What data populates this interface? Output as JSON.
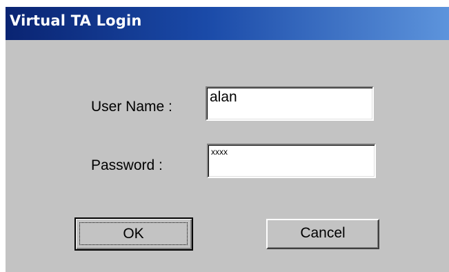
{
  "window": {
    "title": "Virtual TA Login"
  },
  "form": {
    "username_label": "User Name :",
    "username_value": "alan",
    "password_label": "Password :",
    "password_value": "xxxx"
  },
  "buttons": {
    "ok_label": "OK",
    "cancel_label": "Cancel"
  },
  "colors": {
    "dialog_face": "#c3c3c3",
    "titlebar_start": "#0a2472",
    "titlebar_end": "#5d94dc",
    "title_text": "#ffffff"
  }
}
